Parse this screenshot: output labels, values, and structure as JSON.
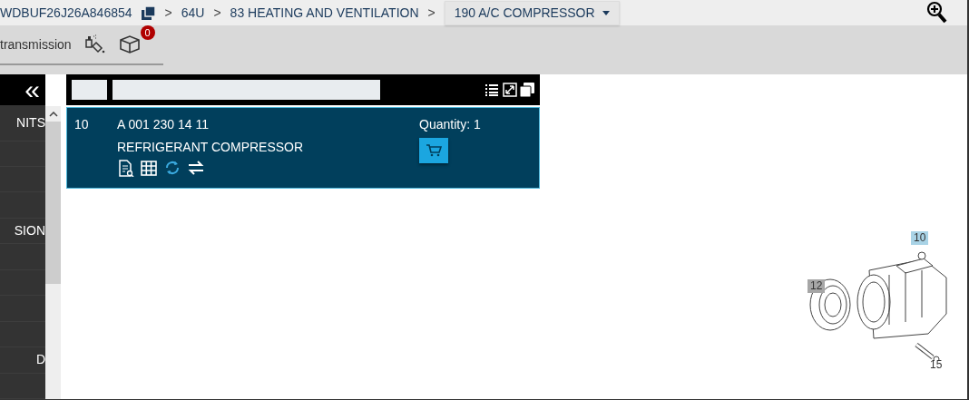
{
  "breadcrumb": {
    "vin": "WDBUF26J26A846854",
    "items": [
      {
        "separator": ">",
        "label": "64U"
      },
      {
        "separator": ">",
        "label": "83 HEATING AND VENTILATION"
      }
    ],
    "last_separator": ">",
    "dropdown": "190 A/C COMPRESSOR"
  },
  "toolbar": {
    "label": "transmission",
    "cart_count": "0"
  },
  "sidebar": {
    "collapse": "«",
    "items": [
      {
        "label": "NITS"
      },
      {
        "label": "SION"
      },
      {
        "label": "D"
      }
    ]
  },
  "parts": [
    {
      "number": "10",
      "part_no": "A 001 230 14 11",
      "description": "REFRIGERANT COMPRESSOR",
      "quantity": "Quantity: 1"
    }
  ],
  "diagram": {
    "callouts": [
      {
        "label": "10",
        "color": "#a9d3e6"
      },
      {
        "label": "12",
        "color": "#a6a6a6"
      },
      {
        "label": "15"
      }
    ]
  }
}
